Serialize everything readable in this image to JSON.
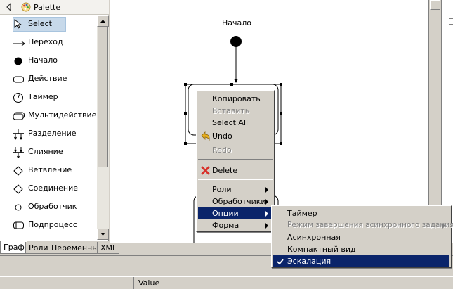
{
  "palette": {
    "title": "Palette",
    "items": [
      {
        "label": "Select",
        "icon": "arrow-pointer-icon"
      },
      {
        "label": "Переход",
        "icon": "transition-arrow-icon"
      },
      {
        "label": "Начало",
        "icon": "start-node-icon"
      },
      {
        "label": "Действие",
        "icon": "action-rect-icon"
      },
      {
        "label": "Таймер",
        "icon": "timer-icon"
      },
      {
        "label": "Мультидействие",
        "icon": "multi-action-icon"
      },
      {
        "label": "Разделение",
        "icon": "fork-icon"
      },
      {
        "label": "Слияние",
        "icon": "join-icon"
      },
      {
        "label": "Ветвление",
        "icon": "decision-diamond-icon"
      },
      {
        "label": "Соединение",
        "icon": "merge-diamond-icon"
      },
      {
        "label": "Обработчик",
        "icon": "handler-circle-icon"
      },
      {
        "label": "Подпроцесс",
        "icon": "subprocess-icon"
      }
    ]
  },
  "tabs": [
    {
      "label": "Граф",
      "active": true
    },
    {
      "label": "Роли",
      "active": false
    },
    {
      "label": "Переменные",
      "active": false
    },
    {
      "label": "XML",
      "active": false
    }
  ],
  "diagram": {
    "start_label": "Начало"
  },
  "context_menu": {
    "items": [
      {
        "label": "Копировать",
        "enabled": true
      },
      {
        "label": "Вставить",
        "enabled": false
      },
      {
        "label": "Select All",
        "enabled": true
      },
      {
        "label": "Undo",
        "enabled": true,
        "icon": "undo-icon"
      },
      {
        "label": "Redo",
        "enabled": false
      },
      {
        "label": "Delete",
        "enabled": true,
        "icon": "delete-x-icon"
      },
      {
        "label": "Роли",
        "submenu": true
      },
      {
        "label": "Обработчики",
        "submenu": true
      },
      {
        "label": "Опции",
        "submenu": true,
        "highlighted": true
      },
      {
        "label": "Форма",
        "submenu": true
      }
    ]
  },
  "submenu": {
    "items": [
      {
        "label": "Таймер",
        "enabled": true
      },
      {
        "label": "Режим завершения асинхронного задания",
        "enabled": false,
        "submenu": true
      },
      {
        "label": "Асинхронная",
        "enabled": true
      },
      {
        "label": "Компактный вид",
        "enabled": true
      },
      {
        "label": "Эскалация",
        "enabled": true,
        "checked": true,
        "highlighted": true
      }
    ]
  },
  "properties": {
    "value_header": "Value"
  },
  "colors": {
    "menu_highlight": "#0a246a",
    "delete_icon": "#d8312a",
    "undo_icon": "#e8b020"
  }
}
